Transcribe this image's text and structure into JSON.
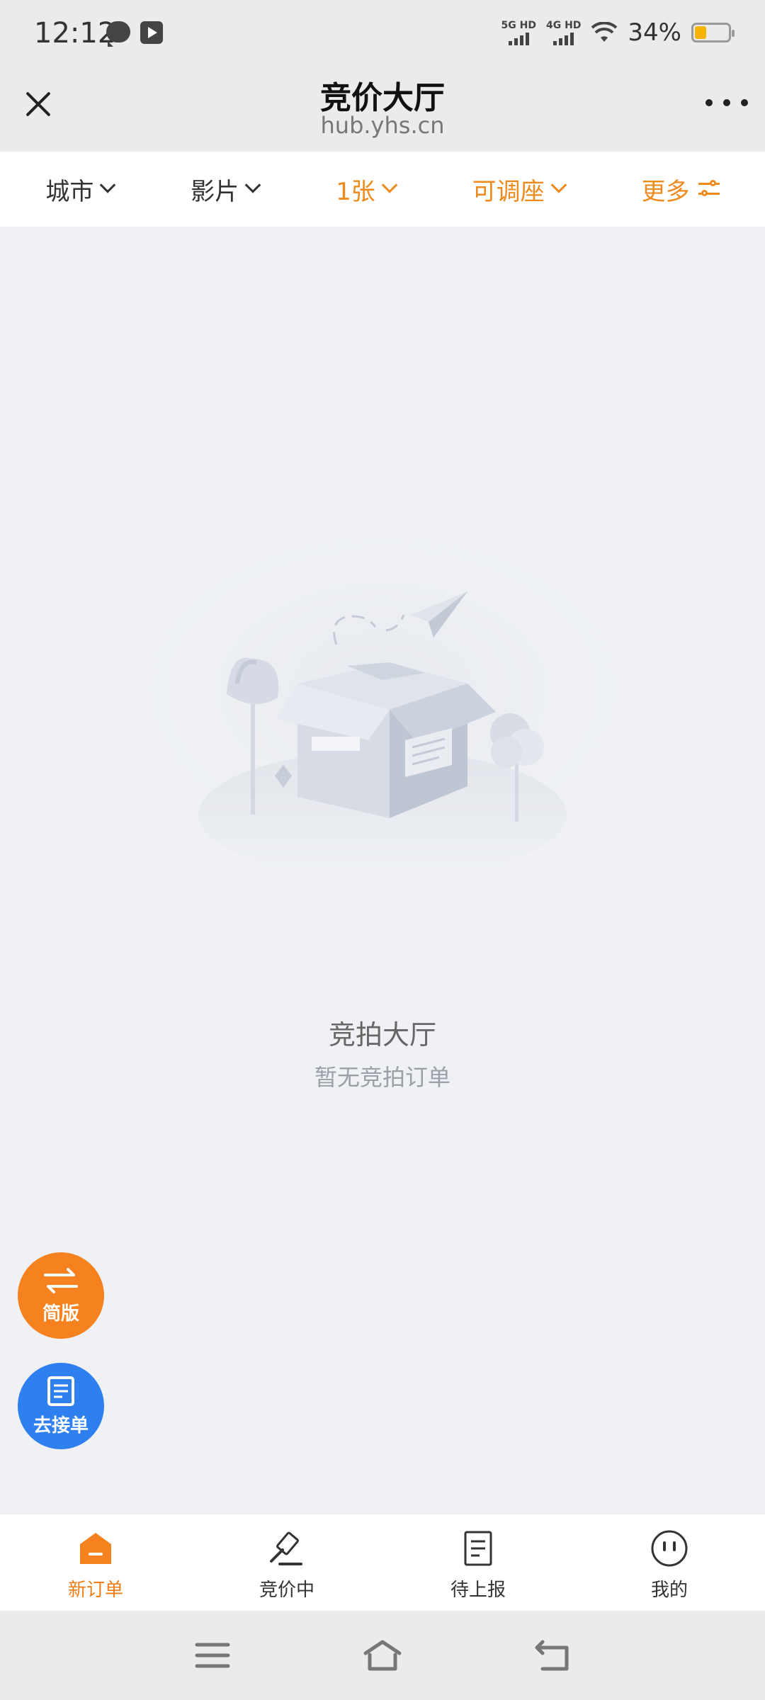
{
  "status_bar": {
    "time": "12:12",
    "sim1_label": "5G HD",
    "sim2_label": "4G HD",
    "battery_percent": "34%",
    "battery_level": 0.34,
    "battery_color": "#f6b400"
  },
  "header": {
    "title": "竞价大厅",
    "subtitle": "hub.yhs.cn"
  },
  "filters": [
    {
      "label": "城市",
      "active": false,
      "icon": "chevron-down-icon"
    },
    {
      "label": "影片",
      "active": false,
      "icon": "chevron-down-icon"
    },
    {
      "label": "1张",
      "active": true,
      "icon": "chevron-down-icon"
    },
    {
      "label": "可调座",
      "active": true,
      "icon": "chevron-down-icon"
    },
    {
      "label": "更多",
      "active": true,
      "icon": "sliders-icon"
    }
  ],
  "empty_state": {
    "title": "竞拍大厅",
    "subtitle": "暂无竞拍订单"
  },
  "fabs": {
    "simple_label": "简版",
    "order_label": "去接单"
  },
  "tabs": [
    {
      "label": "新订单",
      "icon": "home-icon",
      "active": true
    },
    {
      "label": "竞价中",
      "icon": "gavel-icon",
      "active": false
    },
    {
      "label": "待上报",
      "icon": "document-icon",
      "active": false
    },
    {
      "label": "我的",
      "icon": "profile-face-icon",
      "active": false
    }
  ],
  "colors": {
    "accent_orange": "#f07c15",
    "fab_orange": "#f5821f",
    "fab_blue": "#2e7ff0",
    "background": "#eff1f4"
  }
}
